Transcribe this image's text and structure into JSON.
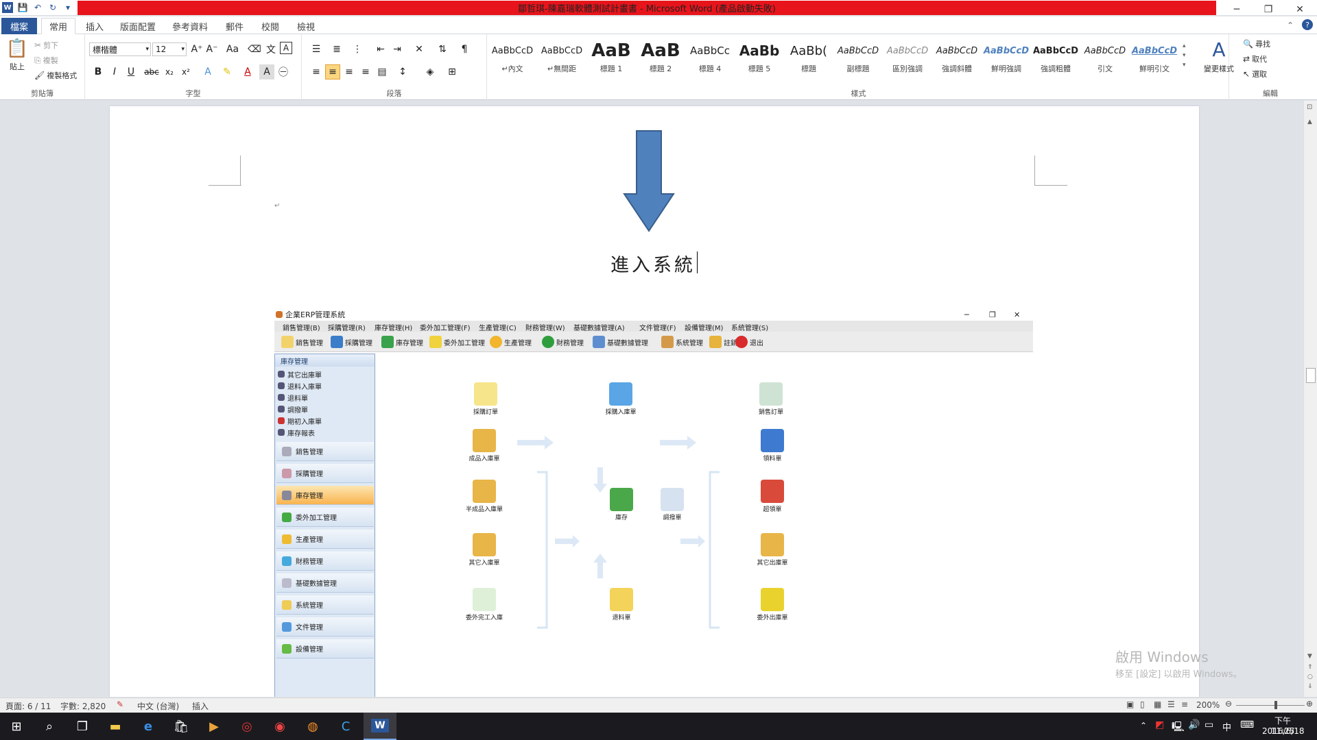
{
  "window": {
    "title": "鄒哲琪-陳嘉瑞軟體測試計畫書 - Microsoft Word (產品啟動失敗)",
    "controls": [
      "─",
      "❐",
      "✕"
    ]
  },
  "ribbon_tabs": [
    "檔案",
    "常用",
    "插入",
    "版面配置",
    "參考資料",
    "郵件",
    "校閱",
    "檢視"
  ],
  "clipboard": {
    "paste": "貼上",
    "cut": "剪下",
    "copy": "複製",
    "format": "複製格式",
    "label": "剪貼簿"
  },
  "font": {
    "name": "標楷體",
    "size": "12",
    "label": "字型"
  },
  "paragraph": {
    "label": "段落"
  },
  "styles": {
    "label": "樣式",
    "change": "變更樣式",
    "items": [
      {
        "preview": "AaBbCcD",
        "name": "↵內文"
      },
      {
        "preview": "AaBbCcD",
        "name": "↵無間距"
      },
      {
        "preview": "AaB",
        "name": "標題 1"
      },
      {
        "preview": "AaB",
        "name": "標題 2"
      },
      {
        "preview": "AaBbCc",
        "name": "標題 4"
      },
      {
        "preview": "AaBb",
        "name": "標題 5"
      },
      {
        "preview": "AaBb(",
        "name": "標題"
      },
      {
        "preview": "AaBbCcD",
        "name": "副標題"
      },
      {
        "preview": "AaBbCcD",
        "name": "區別強調"
      },
      {
        "preview": "AaBbCcD",
        "name": "強調斜體"
      },
      {
        "preview": "AaBbCcD",
        "name": "鮮明強調"
      },
      {
        "preview": "AaBbCcD",
        "name": "強調粗體"
      },
      {
        "preview": "AaBbCcD",
        "name": "引文"
      },
      {
        "preview": "AaBbCcD",
        "name": "鮮明引文"
      }
    ]
  },
  "editing": {
    "label": "編輯",
    "find": "尋找",
    "replace": "取代",
    "select": "選取"
  },
  "document": {
    "heading": "進入系統",
    "para_mark": "↵"
  },
  "erp": {
    "title": "企業ERP管理系統",
    "menu": [
      "銷售管理(B)",
      "採購管理(R)",
      "庫存管理(H)",
      "委外加工管理(F)",
      "生產管理(C)",
      "財務管理(W)",
      "基礎數據管理(A)",
      "文件管理(F)",
      "設備管理(M)",
      "系統管理(S)"
    ],
    "toolbar": [
      "銷售管理",
      "採購管理",
      "庫存管理",
      "委外加工管理",
      "生產管理",
      "財務管理",
      "基礎數據管理",
      "系統管理",
      "註銷",
      "退出"
    ],
    "nav_header": "庫存管理",
    "nav_items": [
      "其它出庫單",
      "退料入庫單",
      "退料單",
      "調撥單",
      "期初入庫單",
      "庫存報表"
    ],
    "nav_buttons": [
      "銷售管理",
      "採購管理",
      "庫存管理",
      "委外加工管理",
      "生產管理",
      "財務管理",
      "基礎數據管理",
      "系統管理",
      "文件管理",
      "設備管理"
    ],
    "flow": {
      "purchase_order": "採購訂單",
      "purchase_in": "採購入庫單",
      "sales_order": "銷售訂單",
      "product_in": "成品入庫單",
      "semi_in": "半成品入庫單",
      "other_in": "其它入庫單",
      "outsource_in": "委外完工入庫",
      "stock": "庫存",
      "transfer": "調撥單",
      "return": "退料單",
      "pick": "領料單",
      "over_pick": "超領單",
      "other_out": "其它出庫單",
      "outsource_out": "委外出庫單"
    }
  },
  "watermark": {
    "line1": "啟用 Windows",
    "line2": "移至 [設定] 以啟用 Windows。"
  },
  "status": {
    "page": "頁面: 6 / 11",
    "words": "字數: 2,820",
    "lang": "中文 (台灣)",
    "mode": "插入",
    "zoom": "200%"
  },
  "clock": {
    "time": "下午 11:25",
    "date": "2016/6/18"
  },
  "tray_ime": "中"
}
